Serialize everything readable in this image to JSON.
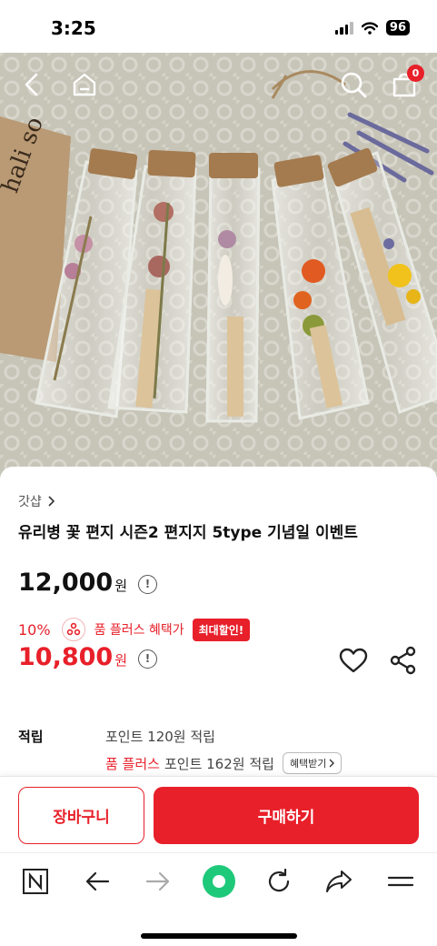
{
  "status_bar": {
    "time": "3:25",
    "battery": "96"
  },
  "header": {
    "cart_count": "0"
  },
  "product": {
    "brand": "갓샵",
    "title": "유리병 꽃 편지 시즌2 편지지 5type 기념일 이벤트",
    "original_price": "12,000",
    "currency": "원",
    "discount_rate": "10%",
    "plus_benefit_text": "품 플러스 혜택가",
    "max_discount_badge": "최대할인!",
    "final_price": "10,800"
  },
  "points": {
    "label": "적립",
    "line1": "포인트 120원 적립",
    "line2_prefix": "품 플러스",
    "line2_text": "포인트 162원 적립",
    "claim_button": "혜택받기"
  },
  "actions": {
    "cart_label": "장바구니",
    "buy_label": "구매하기"
  },
  "colors": {
    "accent": "#e8202a",
    "browser_green": "#1ec97a"
  },
  "icons": [
    "back-icon",
    "home-icon",
    "search-icon",
    "cart-icon",
    "info-icon",
    "heart-icon",
    "share-icon",
    "naver-icon",
    "forward-icon",
    "reload-icon",
    "menu-icon"
  ]
}
